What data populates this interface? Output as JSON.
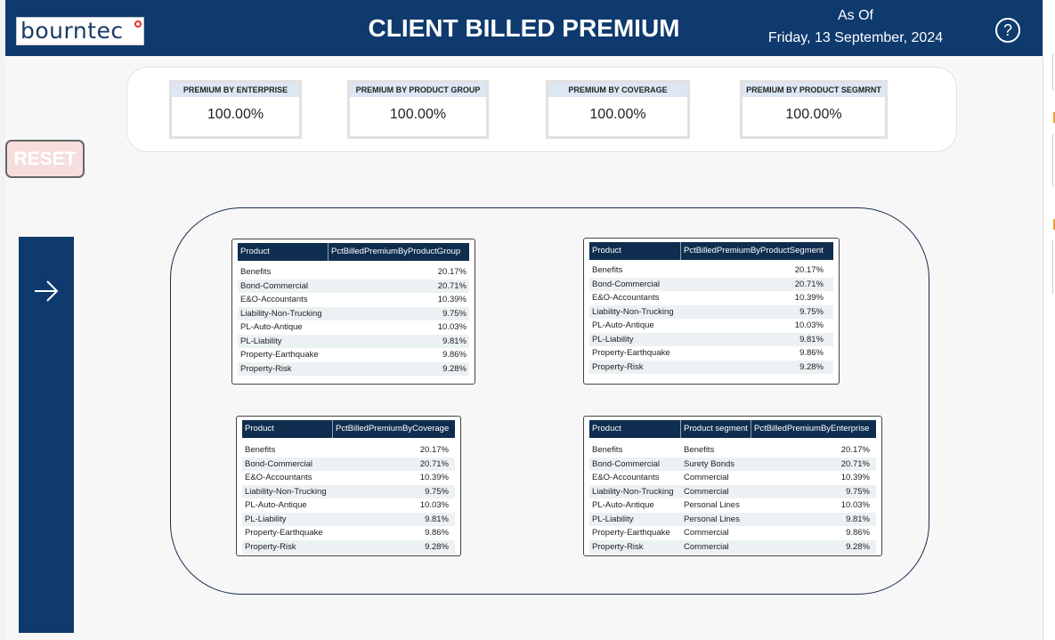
{
  "header": {
    "logo": "bourntec",
    "title": "CLIENT BILLED PREMIUM",
    "as_of_label": "As Of",
    "as_of_date": "Friday, 13 September, 2024",
    "help_icon": "?"
  },
  "kpis": [
    {
      "label": "PREMIUM BY ENTERPRISE",
      "value": "100.00%"
    },
    {
      "label": "PREMIUM BY PRODUCT GROUP",
      "value": "100.00%"
    },
    {
      "label": "PREMIUM BY COVERAGE",
      "value": "100.00%"
    },
    {
      "label": "PREMIUM BY PRODUCT SEGMRNT",
      "value": "100.00%"
    }
  ],
  "reset_label": "RESET",
  "products": [
    "Benefits",
    "Bond-Commercial",
    "E&O-Accountants",
    "Liability-Non-Trucking",
    "PL-Auto-Antique",
    "PL-Liability",
    "Property-Earthquake",
    "Property-Risk"
  ],
  "pct_values": [
    "20.17%",
    "20.71%",
    "10.39%",
    "9.75%",
    "10.03%",
    "9.81%",
    "9.86%",
    "9.28%"
  ],
  "segments": [
    "Benefits",
    "Surety Bonds",
    "Commercial",
    "Commercial",
    "Personal Lines",
    "Personal Lines",
    "Commercial",
    "Commercial"
  ],
  "tables": {
    "group": {
      "col1": "Product",
      "col2": "PctBilledPremiumByProductGroup"
    },
    "segment": {
      "col1": "Product",
      "col2": "PctBilledPremiumByProductSegment"
    },
    "coverage": {
      "col1": "Product",
      "col2": "PctBilledPremiumByCoverage"
    },
    "enterprise": {
      "col1": "Product",
      "col2": "Product segment",
      "col3": "PctBilledPremiumByEnterprise"
    }
  }
}
